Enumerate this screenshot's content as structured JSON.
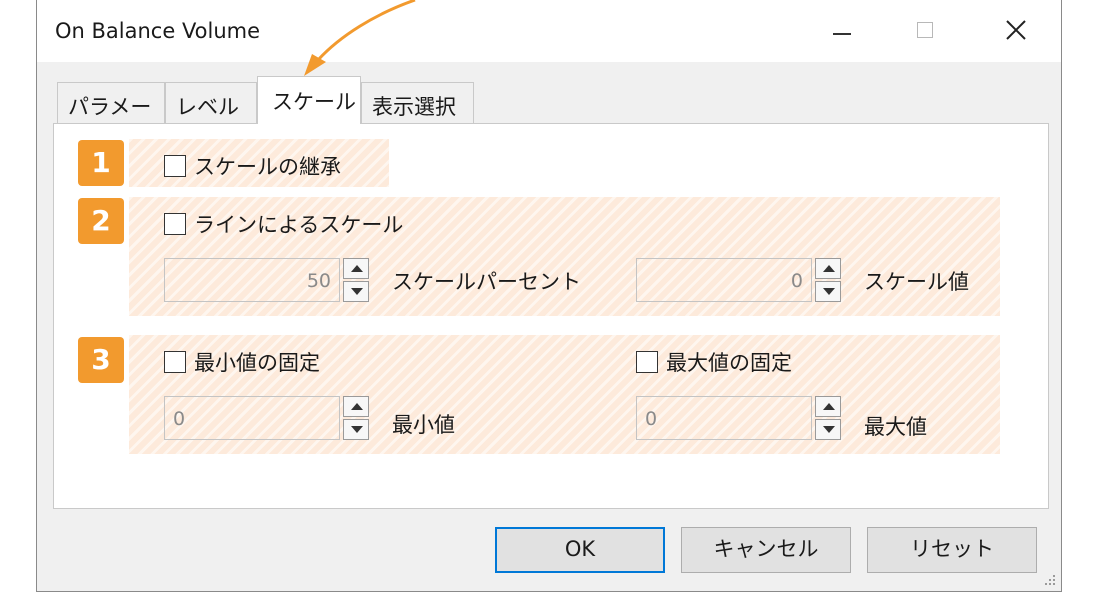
{
  "window": {
    "title": "On Balance Volume"
  },
  "tabs": [
    {
      "label": "パラメータ"
    },
    {
      "label": "レベル"
    },
    {
      "label": "スケール",
      "active": true
    },
    {
      "label": "表示選択"
    }
  ],
  "sections": [
    {
      "badge": "1",
      "checkbox": "スケールの継承"
    },
    {
      "badge": "2",
      "checkbox": "ラインによるスケール",
      "fields": [
        {
          "value": "50",
          "label": "スケールパーセント"
        },
        {
          "value": "0",
          "label": "スケール値"
        }
      ]
    },
    {
      "badge": "3",
      "checkboxes": [
        "最小値の固定",
        "最大値の固定"
      ],
      "fields": [
        {
          "value": "0",
          "label": "最小値"
        },
        {
          "value": "0",
          "label": "最大値"
        }
      ]
    }
  ],
  "buttons": {
    "ok": "OK",
    "cancel": "キャンセル",
    "reset": "リセット"
  },
  "colors": {
    "badge": "#f29a2e",
    "highlight": "#fdeadb",
    "arrow": "#f29a2e",
    "focus": "#0078d7"
  }
}
